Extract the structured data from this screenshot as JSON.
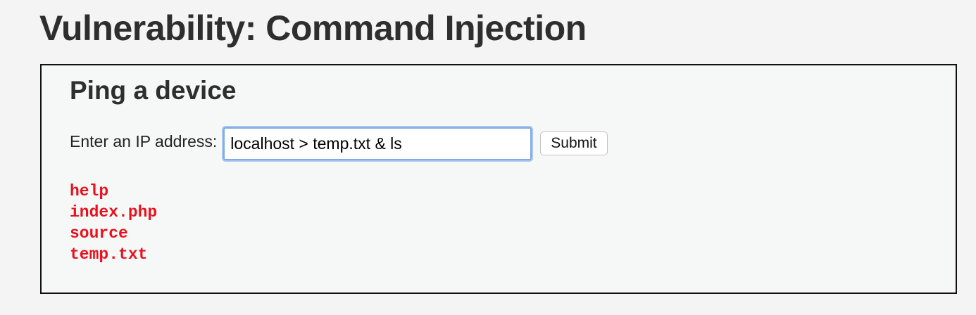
{
  "page": {
    "title": "Vulnerability: Command Injection"
  },
  "section": {
    "title": "Ping a device"
  },
  "form": {
    "label": "Enter an IP address:",
    "input_value": "localhost > temp.txt & ls",
    "submit_label": "Submit"
  },
  "output": {
    "color": "#e8111c",
    "lines": [
      "help",
      "index.php",
      "source",
      "temp.txt"
    ]
  }
}
